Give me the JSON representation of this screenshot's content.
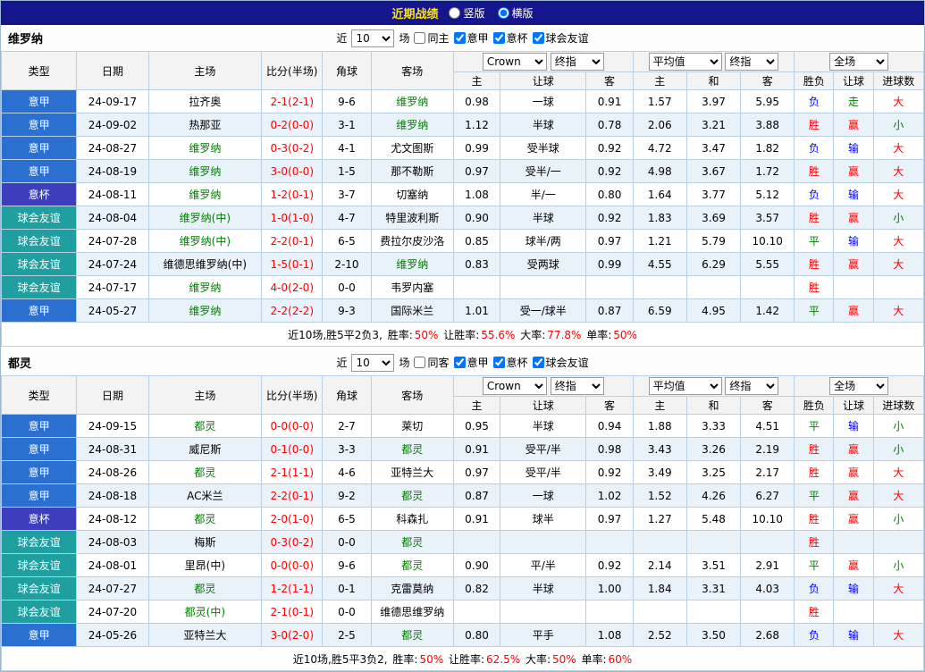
{
  "topbar": {
    "title": "近期战绩",
    "vertical_label": "竖版",
    "horizontal_label": "横版",
    "vertical_selected": false,
    "horizontal_selected": true
  },
  "labels": {
    "near": "近",
    "games": "场"
  },
  "table_header": {
    "type": "类型",
    "date": "日期",
    "home": "主场",
    "score": "比分(半场)",
    "corner": "角球",
    "away": "客场",
    "bookmaker": "Crown",
    "final_index": "终指",
    "average": "平均值",
    "full_match": "全场",
    "home_short": "主",
    "draw_short": "和",
    "away_short": "客",
    "handicap": "让球",
    "result": "胜负",
    "goals": "进球数"
  },
  "colors": {
    "win": "#ff0000",
    "draw": "#008000",
    "loss": "#0000ff",
    "serie_a_bg": "#2b6fd0",
    "cup_bg": "#3d3dbe",
    "friendly_bg": "#1f9f9f",
    "topbar_bg": "#15158c",
    "title_text": "#ffe400",
    "focus_team": "#008000",
    "score_text": "#ff0000",
    "border": "#b9cfe4",
    "row_alt": "#e9f1f9"
  },
  "sections": [
    {
      "team": "维罗纳",
      "filters": {
        "count": "10",
        "same": {
          "label": "同主",
          "checked": false
        },
        "leagues": [
          {
            "label": "意甲",
            "checked": true
          },
          {
            "label": "意杯",
            "checked": true
          },
          {
            "label": "球会友谊",
            "checked": true
          }
        ]
      },
      "rows": [
        [
          "意甲",
          "24-09-17",
          "拉齐奥",
          false,
          "2-1(2-1)",
          "9-6",
          "维罗纳",
          true,
          "0.98",
          "一球",
          "0.91",
          "1.57",
          "3.97",
          "5.95",
          "负",
          "走",
          "大"
        ],
        [
          "意甲",
          "24-09-02",
          "热那亚",
          false,
          "0-2(0-0)",
          "3-1",
          "维罗纳",
          true,
          "1.12",
          "半球",
          "0.78",
          "2.06",
          "3.21",
          "3.88",
          "胜",
          "赢",
          "小"
        ],
        [
          "意甲",
          "24-08-27",
          "维罗纳",
          true,
          "0-3(0-2)",
          "4-1",
          "尤文图斯",
          false,
          "0.99",
          "受半球",
          "0.92",
          "4.72",
          "3.47",
          "1.82",
          "负",
          "输",
          "大"
        ],
        [
          "意甲",
          "24-08-19",
          "维罗纳",
          true,
          "3-0(0-0)",
          "1-5",
          "那不勒斯",
          false,
          "0.97",
          "受半/一",
          "0.92",
          "4.98",
          "3.67",
          "1.72",
          "胜",
          "赢",
          "大"
        ],
        [
          "意杯",
          "24-08-11",
          "维罗纳",
          true,
          "1-2(0-1)",
          "3-7",
          "切塞纳",
          false,
          "1.08",
          "半/一",
          "0.80",
          "1.64",
          "3.77",
          "5.12",
          "负",
          "输",
          "大"
        ],
        [
          "球会友谊",
          "24-08-04",
          "维罗纳(中)",
          true,
          "1-0(1-0)",
          "4-7",
          "特里波利斯",
          false,
          "0.90",
          "半球",
          "0.92",
          "1.83",
          "3.69",
          "3.57",
          "胜",
          "赢",
          "小"
        ],
        [
          "球会友谊",
          "24-07-28",
          "维罗纳(中)",
          true,
          "2-2(0-1)",
          "6-5",
          "费拉尔皮沙洛",
          false,
          "0.85",
          "球半/两",
          "0.97",
          "1.21",
          "5.79",
          "10.10",
          "平",
          "输",
          "大"
        ],
        [
          "球会友谊",
          "24-07-24",
          "维德思维罗纳(中)",
          false,
          "1-5(0-1)",
          "2-10",
          "维罗纳",
          true,
          "0.83",
          "受两球",
          "0.99",
          "4.55",
          "6.29",
          "5.55",
          "胜",
          "赢",
          "大"
        ],
        [
          "球会友谊",
          "24-07-17",
          "维罗纳",
          true,
          "4-0(2-0)",
          "0-0",
          "韦罗内塞",
          false,
          "",
          "",
          "",
          "",
          "",
          "",
          "胜",
          "",
          ""
        ],
        [
          "意甲",
          "24-05-27",
          "维罗纳",
          true,
          "2-2(2-2)",
          "9-3",
          "国际米兰",
          false,
          "1.01",
          "受一/球半",
          "0.87",
          "6.59",
          "4.95",
          "1.42",
          "平",
          "赢",
          "大"
        ]
      ],
      "summary": {
        "prefix": "近10场,胜5平2负3, ",
        "items": [
          {
            "label": "胜率:",
            "value": "50%"
          },
          {
            "label": "让胜率:",
            "value": "55.6%"
          },
          {
            "label": "大率:",
            "value": "77.8%"
          },
          {
            "label": "单率:",
            "value": "50%"
          }
        ]
      }
    },
    {
      "team": "都灵",
      "filters": {
        "count": "10",
        "same": {
          "label": "同客",
          "checked": false
        },
        "leagues": [
          {
            "label": "意甲",
            "checked": true
          },
          {
            "label": "意杯",
            "checked": true
          },
          {
            "label": "球会友谊",
            "checked": true
          }
        ]
      },
      "rows": [
        [
          "意甲",
          "24-09-15",
          "都灵",
          true,
          "0-0(0-0)",
          "2-7",
          "莱切",
          false,
          "0.95",
          "半球",
          "0.94",
          "1.88",
          "3.33",
          "4.51",
          "平",
          "输",
          "小"
        ],
        [
          "意甲",
          "24-08-31",
          "威尼斯",
          false,
          "0-1(0-0)",
          "3-3",
          "都灵",
          true,
          "0.91",
          "受平/半",
          "0.98",
          "3.43",
          "3.26",
          "2.19",
          "胜",
          "赢",
          "小"
        ],
        [
          "意甲",
          "24-08-26",
          "都灵",
          true,
          "2-1(1-1)",
          "4-6",
          "亚特兰大",
          false,
          "0.97",
          "受平/半",
          "0.92",
          "3.49",
          "3.25",
          "2.17",
          "胜",
          "赢",
          "大"
        ],
        [
          "意甲",
          "24-08-18",
          "AC米兰",
          false,
          "2-2(0-1)",
          "9-2",
          "都灵",
          true,
          "0.87",
          "一球",
          "1.02",
          "1.52",
          "4.26",
          "6.27",
          "平",
          "赢",
          "大"
        ],
        [
          "意杯",
          "24-08-12",
          "都灵",
          true,
          "2-0(1-0)",
          "6-5",
          "科森扎",
          false,
          "0.91",
          "球半",
          "0.97",
          "1.27",
          "5.48",
          "10.10",
          "胜",
          "赢",
          "小"
        ],
        [
          "球会友谊",
          "24-08-03",
          "梅斯",
          false,
          "0-3(0-2)",
          "0-0",
          "都灵",
          true,
          "",
          "",
          "",
          "",
          "",
          "",
          "胜",
          "",
          ""
        ],
        [
          "球会友谊",
          "24-08-01",
          "里昂(中)",
          false,
          "0-0(0-0)",
          "9-6",
          "都灵",
          true,
          "0.90",
          "平/半",
          "0.92",
          "2.14",
          "3.51",
          "2.91",
          "平",
          "赢",
          "小"
        ],
        [
          "球会友谊",
          "24-07-27",
          "都灵",
          true,
          "1-2(1-1)",
          "0-1",
          "克雷莫纳",
          false,
          "0.82",
          "半球",
          "1.00",
          "1.84",
          "3.31",
          "4.03",
          "负",
          "输",
          "大"
        ],
        [
          "球会友谊",
          "24-07-20",
          "都灵(中)",
          true,
          "2-1(0-1)",
          "0-0",
          "维德思维罗纳",
          false,
          "",
          "",
          "",
          "",
          "",
          "",
          "胜",
          "",
          ""
        ],
        [
          "意甲",
          "24-05-26",
          "亚特兰大",
          false,
          "3-0(2-0)",
          "2-5",
          "都灵",
          true,
          "0.80",
          "平手",
          "1.08",
          "2.52",
          "3.50",
          "2.68",
          "负",
          "输",
          "大"
        ]
      ],
      "summary": {
        "prefix": "近10场,胜5平3负2, ",
        "items": [
          {
            "label": "胜率:",
            "value": "50%"
          },
          {
            "label": "让胜率:",
            "value": "62.5%"
          },
          {
            "label": "大率:",
            "value": "50%"
          },
          {
            "label": "单率:",
            "value": "60%"
          }
        ]
      }
    }
  ]
}
